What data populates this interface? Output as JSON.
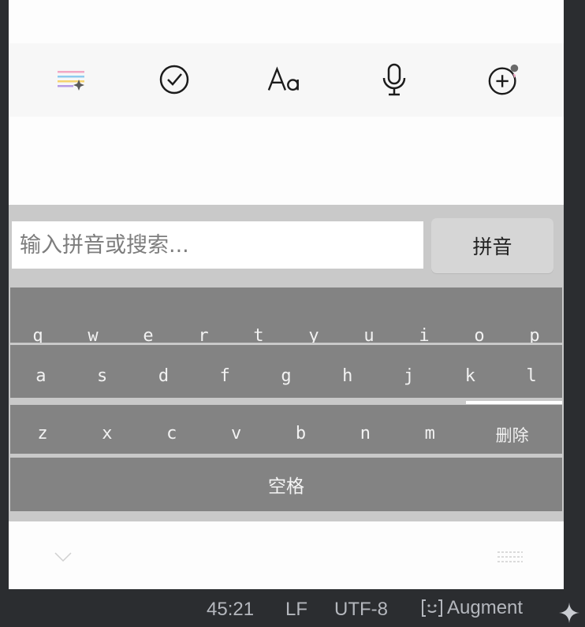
{
  "keyboard": {
    "search_placeholder": "输入拼音或搜索...",
    "mode_button": "拼音",
    "rows": [
      [
        "q",
        "w",
        "e",
        "r",
        "t",
        "y",
        "u",
        "i",
        "o",
        "p"
      ],
      [
        "a",
        "s",
        "d",
        "f",
        "g",
        "h",
        "j",
        "k",
        "l"
      ],
      [
        "z",
        "x",
        "c",
        "v",
        "b",
        "n",
        "m"
      ]
    ],
    "delete_label": "删除",
    "space_label": "空格"
  },
  "toolbar": {
    "icons": [
      "menu-sparkle-icon",
      "check-circle-icon",
      "text-format-icon",
      "microphone-icon",
      "add-circle-icon"
    ]
  },
  "status_bar": {
    "position": "45:21",
    "line_ending": "LF",
    "encoding": "UTF-8",
    "augment": "Augment"
  },
  "colors": {
    "key_bg": "#838383",
    "keyboard_bg": "#c9c9c9",
    "statusbar_bg": "#2b2d30",
    "statusbar_text": "#b4b7bd"
  }
}
